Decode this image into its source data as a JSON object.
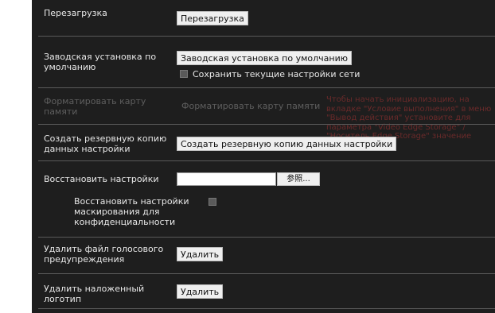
{
  "reboot": {
    "label": "Перезагрузка",
    "button": "Перезагрузка"
  },
  "factory_reset": {
    "label": "Заводская установка по умолчанию",
    "button": "Заводская установка по умолчанию",
    "checkbox_label": "Сохранить текущие настройки сети",
    "checkbox_checked": false
  },
  "format_card": {
    "label": "Форматировать карту памяти",
    "button": "Форматировать карту памяти",
    "note": "Чтобы начать инициализацию, на вкладке \"Условие выполнения\" в меню \"Вывод действия\" установите для параметра \"Video Edge Storage\" / \"Носитель Edge Storage\" значение \"Выкл.\"."
  },
  "backup": {
    "label": "Создать резервную копию данных настройки",
    "button": "Создать резервную копию данных настройки"
  },
  "restore": {
    "label": "Восстановить настройки",
    "file_value": "",
    "browse_button": "参照...",
    "privacy_label": "Восстановить настройки маскирования для конфиденциальности",
    "privacy_checked": false
  },
  "delete_voice": {
    "label": "Удалить файл голосового предупреждения",
    "button": "Удалить"
  },
  "delete_logo": {
    "label": "Удалить наложенный логотип",
    "button": "Удалить"
  },
  "colors": {
    "panel_bg": "#1e1e1e",
    "disabled_text": "#5e5e5e",
    "note_text": "#6a2a2a"
  }
}
